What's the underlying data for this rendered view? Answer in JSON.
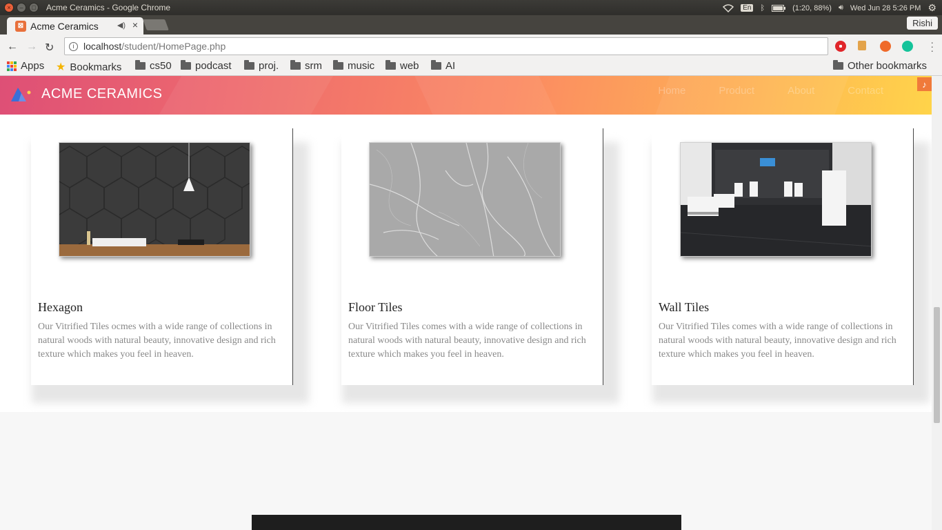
{
  "os": {
    "window_title": "Acme Ceramics - Google Chrome",
    "lang": "En",
    "battery": "(1:20, 88%)",
    "datetime": "Wed Jun 28  5:26 PM"
  },
  "browser": {
    "tab_title": "Acme Ceramics",
    "profile": "Rishi",
    "url_host": "localhost",
    "url_path": "/student/HomePage.php",
    "bookmarks": {
      "apps": "Apps",
      "bookmarks": "Bookmarks",
      "folders": [
        "cs50",
        "podcast",
        "proj.",
        "srm",
        "music",
        "web",
        "AI"
      ],
      "other": "Other bookmarks"
    }
  },
  "site": {
    "brand": "ACME CERAMICS",
    "nav": [
      "Home",
      "Product",
      "About",
      "Contact"
    ],
    "gradient": [
      "#de4f76",
      "#fb8a62",
      "#ffd44a"
    ]
  },
  "products": [
    {
      "title": "Hexagon",
      "description": "Our Vitrified Tiles ocmes with a wide range of collections in natural woods with natural beauty, innovative design and rich texture which makes you feel in heaven."
    },
    {
      "title": "Floor Tiles",
      "description": "Our Vitrified Tiles comes with a wide range of collections in natural woods with natural beauty, innovative design and rich texture which makes you feel in heaven."
    },
    {
      "title": "Wall Tiles",
      "description": "Our Vitrified Tiles comes with a wide range of collections in natural woods with natural beauty, innovative design and rich texture which makes you feel in heaven."
    }
  ]
}
